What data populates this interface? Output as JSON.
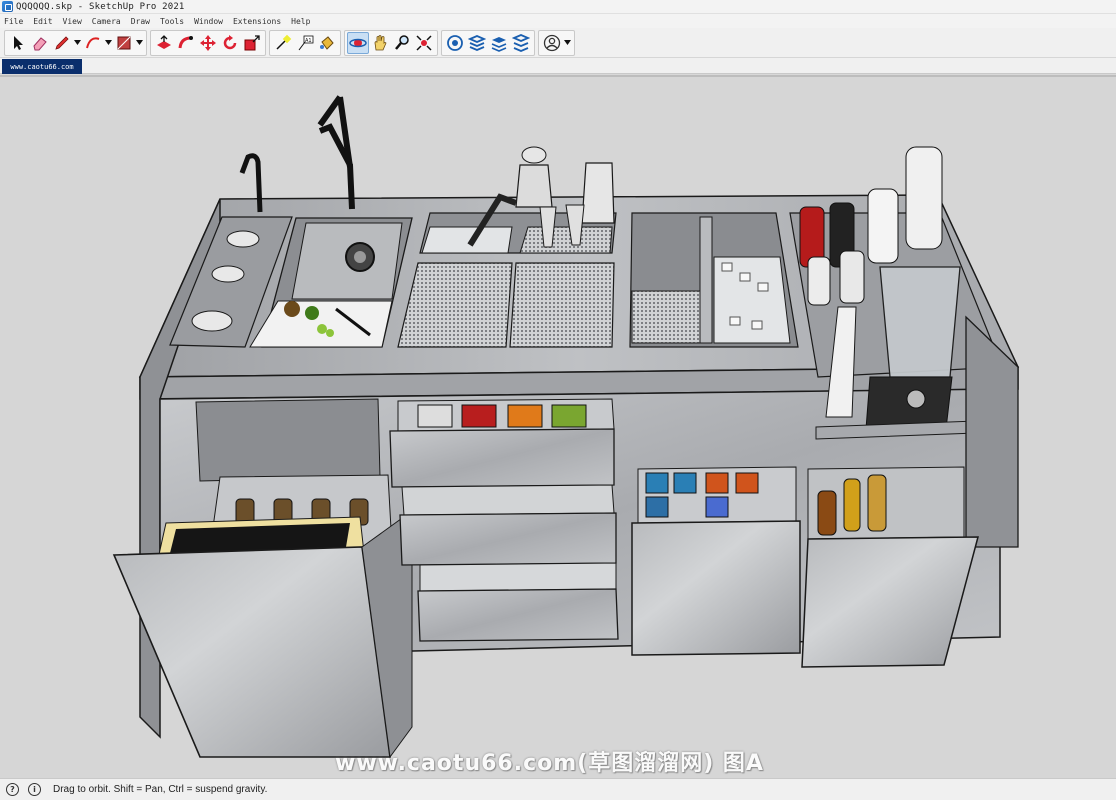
{
  "window": {
    "title": "QQQQQQ.skp - SketchUp Pro 2021"
  },
  "menu": [
    "File",
    "Edit",
    "View",
    "Camera",
    "Draw",
    "Tools",
    "Window",
    "Extensions",
    "Help"
  ],
  "toolbar": {
    "icons": [
      "select-icon",
      "eraser-icon",
      "pencil-line-icon",
      "arc-icon",
      "rectangle-icon",
      "push-pull-icon",
      "follow-me-icon",
      "move-icon",
      "rotate-icon",
      "scale-icon",
      "tape-measure-icon",
      "text-label-icon",
      "paint-bucket-icon",
      "orbit-icon",
      "pan-icon",
      "zoom-icon",
      "zoom-extents-icon",
      "3d-warehouse-icon",
      "extension-warehouse-icon",
      "layout-icon",
      "extension-manager-icon",
      "user-account-icon"
    ],
    "active_tool": "orbit-icon"
  },
  "tabs": [
    {
      "label": "www.caotu66.com"
    }
  ],
  "viewport": {
    "background": "#d6d6d6",
    "watermark": "www.caotu66.com(草图溜溜网) 图A"
  },
  "status": {
    "text": "Drag to orbit. Shift = Pan, Ctrl = suspend gravity."
  },
  "colors": {
    "steel": "#b4b6ba",
    "steel_dark": "#8d8f93",
    "outline": "#1a1a1a",
    "active_tab": "#0a2e6c"
  }
}
